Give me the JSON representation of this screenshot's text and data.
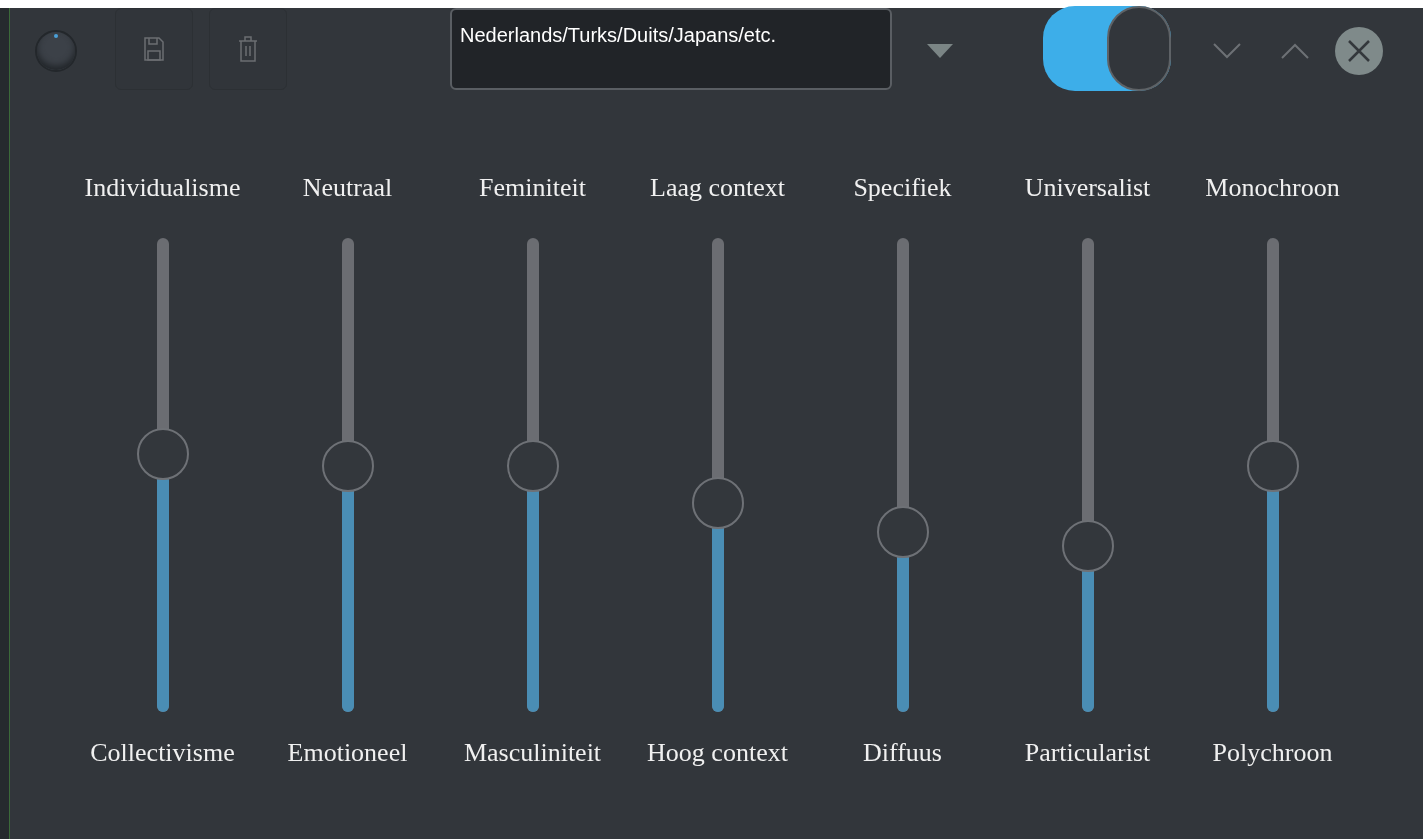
{
  "toolbar": {
    "language_field": {
      "value": "Nederlands/Turks/Duits/Japans/etc."
    },
    "toggle": {
      "on": true
    }
  },
  "sliders": [
    {
      "top_label": "Individualisme",
      "bottom_label": "Collectivisme",
      "level": 0.545
    },
    {
      "top_label": "Neutraal",
      "bottom_label": "Emotioneel",
      "level": 0.52
    },
    {
      "top_label": "Feminiteit",
      "bottom_label": "Masculiniteit",
      "level": 0.52
    },
    {
      "top_label": "Laag context",
      "bottom_label": "Hoog context",
      "level": 0.44
    },
    {
      "top_label": "Specifiek",
      "bottom_label": "Diffuus",
      "level": 0.38
    },
    {
      "top_label": "Universalist",
      "bottom_label": "Particularist",
      "level": 0.35
    },
    {
      "top_label": "Monochroon",
      "bottom_label": "Polychroon",
      "level": 0.52
    }
  ]
}
